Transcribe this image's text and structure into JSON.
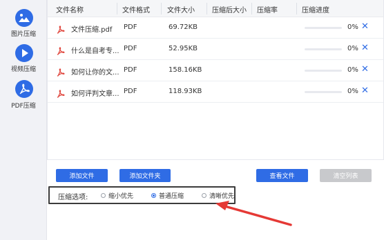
{
  "sidebar": {
    "items": [
      {
        "label": "图片压缩",
        "icon": "image-icon"
      },
      {
        "label": "视频压缩",
        "icon": "play-icon"
      },
      {
        "label": "PDF压缩",
        "icon": "pdf-icon",
        "active": true
      }
    ]
  },
  "table": {
    "columns": [
      "文件名称",
      "文件格式",
      "文件大小",
      "压缩后大小",
      "压缩率",
      "压缩进度"
    ],
    "rows": [
      {
        "name": "文件压缩.pdf",
        "format": "PDF",
        "size": "69.72KB",
        "after": "",
        "rate": "",
        "progress": 0,
        "progress_text": "0%"
      },
      {
        "name": "什么是自考专...",
        "format": "PDF",
        "size": "52.95KB",
        "after": "",
        "rate": "",
        "progress": 0,
        "progress_text": "0%"
      },
      {
        "name": "如何让你的文...",
        "format": "PDF",
        "size": "158.16KB",
        "after": "",
        "rate": "",
        "progress": 0,
        "progress_text": "0%"
      },
      {
        "name": "如何评判文章...",
        "format": "PDF",
        "size": "118.93KB",
        "after": "",
        "rate": "",
        "progress": 0,
        "progress_text": "0%"
      }
    ],
    "remove_symbol": "✕"
  },
  "buttons": {
    "add_file": "添加文件",
    "add_folder": "添加文件夹",
    "view_file": "查看文件",
    "clear_list": "清空列表"
  },
  "compression": {
    "label": "压缩选项:",
    "options": [
      "缩小优先",
      "普通压缩",
      "清晰优先"
    ],
    "selected": "普通压缩"
  },
  "colors": {
    "accent": "#2f6ce5",
    "pdf_red": "#e0473e",
    "annotation_arrow": "#e53935",
    "disabled_button": "#c8c9cc"
  }
}
